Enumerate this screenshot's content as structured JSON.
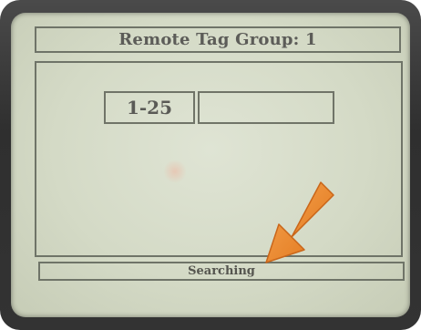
{
  "screen": {
    "title": "Remote Tag Group: 1",
    "tag_range": "1-25",
    "tag_value": "",
    "status": "Searching"
  },
  "colors": {
    "bezel": "#333333",
    "lcd_background": "#d4dac6",
    "lcd_text": "#5a5a56",
    "lcd_border": "#6f7468",
    "arrow": "#f08a2c"
  },
  "icons": {
    "annotation": "orange-arrow-icon"
  }
}
